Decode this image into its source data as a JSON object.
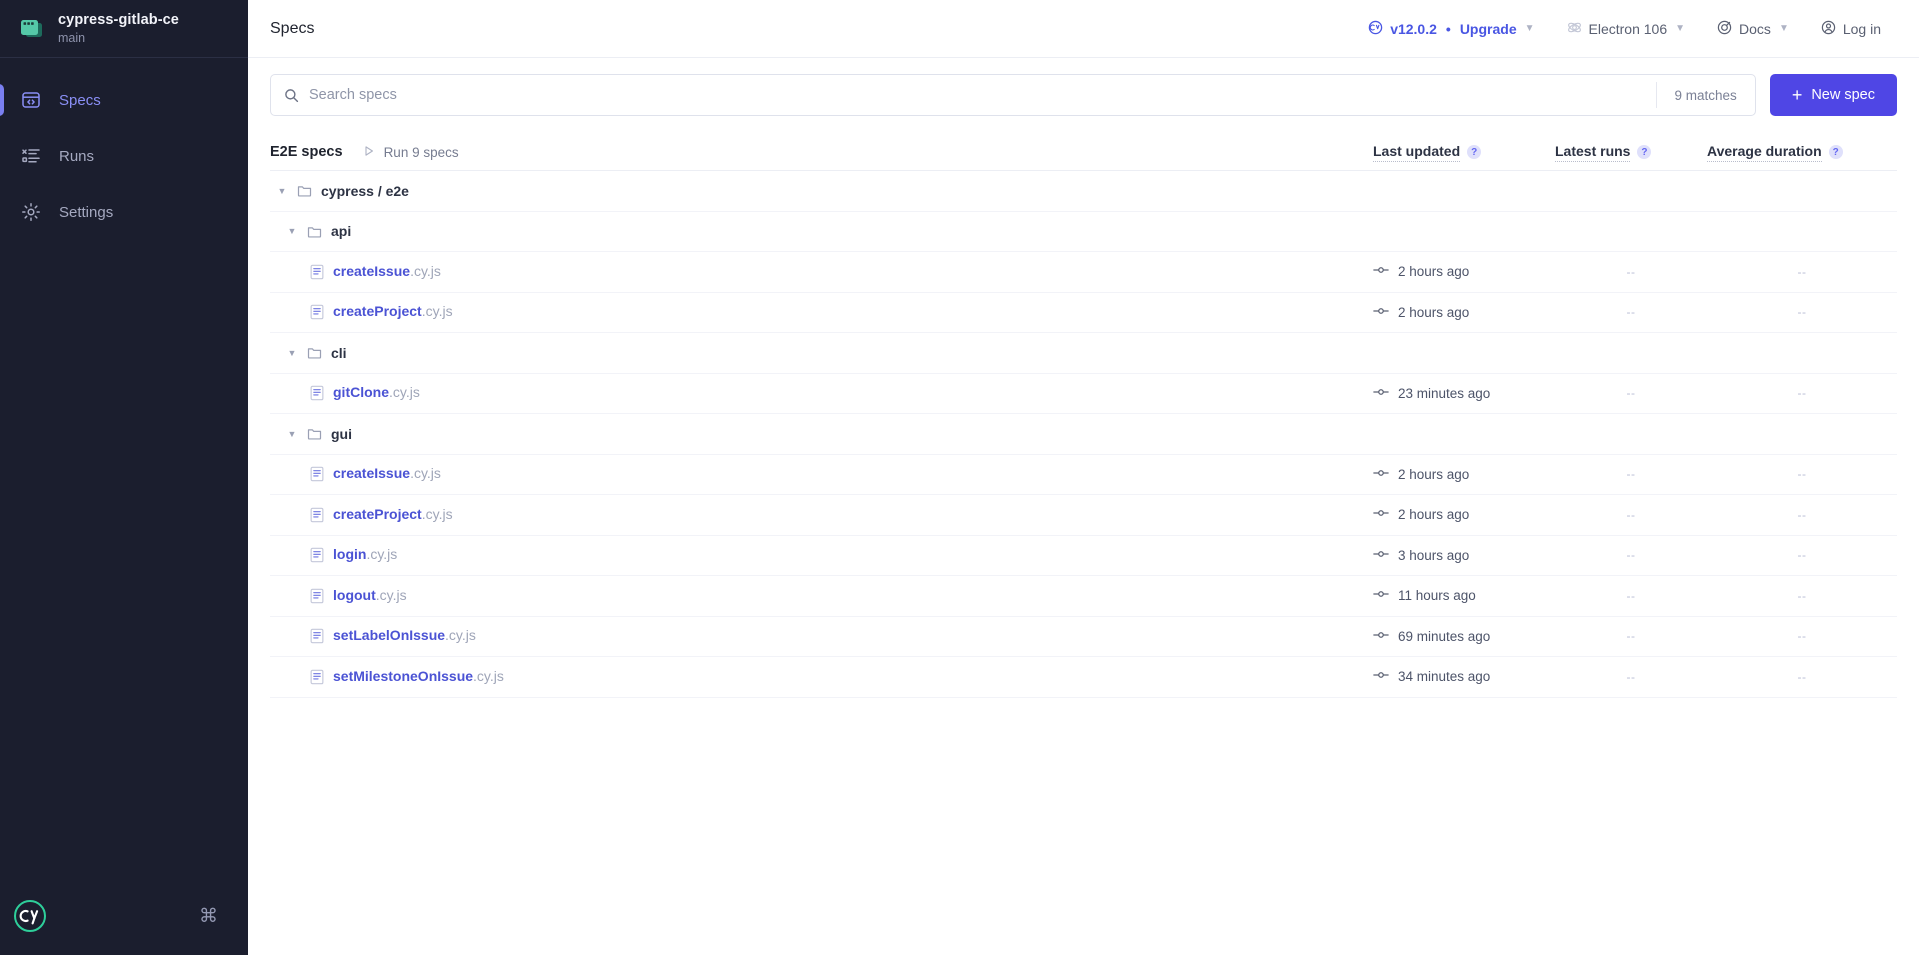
{
  "sidebar": {
    "project": {
      "name": "cypress-gitlab-ce",
      "branch": "main"
    },
    "nav": [
      {
        "label": "Specs",
        "icon": "specs-icon",
        "active": true
      },
      {
        "label": "Runs",
        "icon": "runs-icon",
        "active": false
      },
      {
        "label": "Settings",
        "icon": "gear-icon",
        "active": false
      }
    ],
    "footer": {
      "logo": "cypress-logo",
      "shortcut": "⌘"
    }
  },
  "header": {
    "title": "Specs",
    "items": [
      {
        "label": "v12.0.2",
        "sep": "•",
        "label2": "Upgrade",
        "icon": "cypress-badge-icon",
        "chevron": "⌄",
        "accent": true
      },
      {
        "label": "Electron 106",
        "icon": "electron-icon",
        "chevron": "⌄",
        "accent": false
      },
      {
        "label": "Docs",
        "icon": "docs-icon",
        "chevron": "⌄",
        "accent": false
      },
      {
        "label": "Log in",
        "icon": "user-icon",
        "chevron": "",
        "accent": false
      }
    ]
  },
  "search": {
    "placeholder": "Search specs",
    "value": "",
    "matches": "9 matches",
    "icon": "search-icon"
  },
  "new_spec_button": {
    "label": "New spec",
    "icon": "plus-icon"
  },
  "table": {
    "group_label": "E2E specs",
    "run_specs_label": "Run 9 specs",
    "run_specs_icon": "play-icon",
    "columns": [
      {
        "label": "Last updated",
        "help": "?"
      },
      {
        "label": "Latest runs",
        "help": "?"
      },
      {
        "label": "Average duration",
        "help": "?"
      }
    ],
    "rows": [
      {
        "type": "folder",
        "indent": 1,
        "name": "cypress / e2e",
        "updated": "",
        "runs": "",
        "avg": ""
      },
      {
        "type": "folder",
        "indent": 2,
        "name": "api",
        "updated": "",
        "runs": "",
        "avg": ""
      },
      {
        "type": "spec",
        "indent": 3,
        "name": "createIssue",
        "ext": ".cy.js",
        "updated": "2 hours ago",
        "runs": "--",
        "avg": "--"
      },
      {
        "type": "spec",
        "indent": 3,
        "name": "createProject",
        "ext": ".cy.js",
        "updated": "2 hours ago",
        "runs": "--",
        "avg": "--"
      },
      {
        "type": "folder",
        "indent": 2,
        "name": "cli",
        "updated": "",
        "runs": "",
        "avg": ""
      },
      {
        "type": "spec",
        "indent": 3,
        "name": "gitClone",
        "ext": ".cy.js",
        "updated": "23 minutes ago",
        "runs": "--",
        "avg": "--"
      },
      {
        "type": "folder",
        "indent": 2,
        "name": "gui",
        "updated": "",
        "runs": "",
        "avg": ""
      },
      {
        "type": "spec",
        "indent": 3,
        "name": "createIssue",
        "ext": ".cy.js",
        "updated": "2 hours ago",
        "runs": "--",
        "avg": "--"
      },
      {
        "type": "spec",
        "indent": 3,
        "name": "createProject",
        "ext": ".cy.js",
        "updated": "2 hours ago",
        "runs": "--",
        "avg": "--"
      },
      {
        "type": "spec",
        "indent": 3,
        "name": "login",
        "ext": ".cy.js",
        "updated": "3 hours ago",
        "runs": "--",
        "avg": "--"
      },
      {
        "type": "spec",
        "indent": 3,
        "name": "logout",
        "ext": ".cy.js",
        "updated": "11 hours ago",
        "runs": "--",
        "avg": "--"
      },
      {
        "type": "spec",
        "indent": 3,
        "name": "setLabelOnIssue",
        "ext": ".cy.js",
        "updated": "69 minutes ago",
        "runs": "--",
        "avg": "--"
      },
      {
        "type": "spec",
        "indent": 3,
        "name": "setMilestoneOnIssue",
        "ext": ".cy.js",
        "updated": "34 minutes ago",
        "runs": "--",
        "avg": "--"
      }
    ]
  },
  "colors": {
    "sidebar_bg": "#1b1e2e",
    "accent": "#4f46e5",
    "spec_link": "#4b53d4",
    "active_nav": "#8a8ff5",
    "project_icon": "#55c9a8"
  }
}
